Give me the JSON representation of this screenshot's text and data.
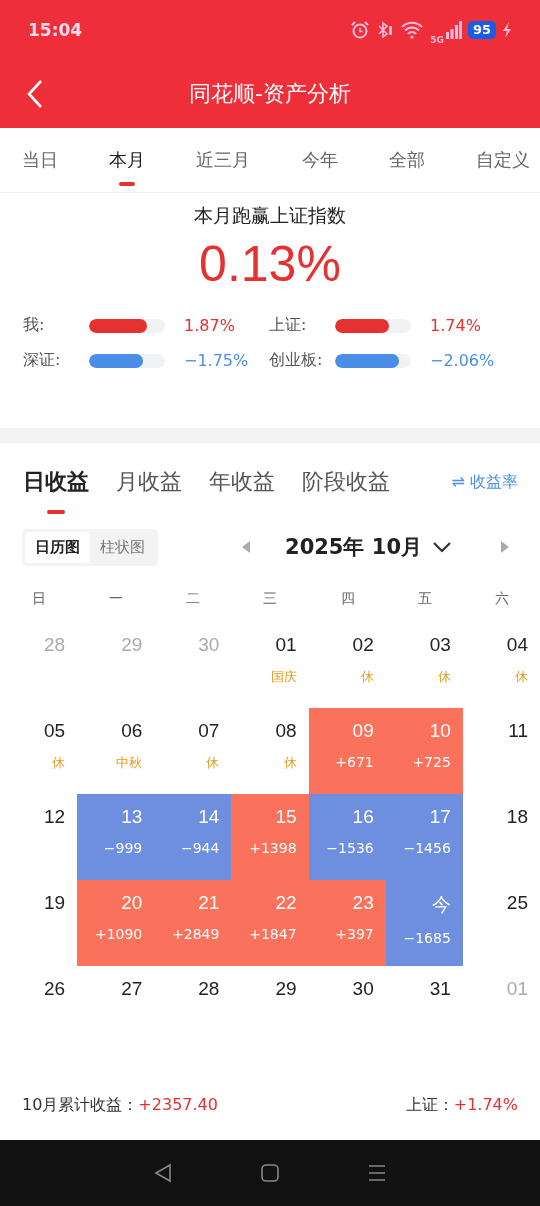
{
  "status_bar": {
    "time": "15:04",
    "network": "5G",
    "battery": "95"
  },
  "header": {
    "title": "同花顺-资产分析"
  },
  "period_tabs": [
    {
      "label": "当日",
      "selected": false
    },
    {
      "label": "本月",
      "selected": true
    },
    {
      "label": "近三月",
      "selected": false
    },
    {
      "label": "今年",
      "selected": false
    },
    {
      "label": "全部",
      "selected": false
    },
    {
      "label": "自定义",
      "selected": false
    }
  ],
  "summary": {
    "headline": "本月跑赢上证指数",
    "value": "0.13%",
    "comparisons": [
      {
        "label": "我:",
        "level": 0.76,
        "value": "1.87%",
        "color": "#e5312f"
      },
      {
        "label": "上证:",
        "level": 0.71,
        "value": "1.74%",
        "color": "#e5312f"
      },
      {
        "label": "深证:",
        "level": 0.71,
        "value": "−1.75%",
        "color": "#4a8fe7"
      },
      {
        "label": "创业板:",
        "level": 0.84,
        "value": "−2.06%",
        "color": "#4a8fe7"
      }
    ]
  },
  "section_tabs": [
    {
      "label": "日收益",
      "selected": true
    },
    {
      "label": "月收益",
      "selected": false
    },
    {
      "label": "年收益",
      "selected": false
    },
    {
      "label": "阶段收益",
      "selected": false
    }
  ],
  "rate_toggle": {
    "icon": "⇌",
    "label": "收益率"
  },
  "view_toggle": [
    {
      "label": "日历图",
      "selected": true
    },
    {
      "label": "柱状图",
      "selected": false
    }
  ],
  "month_picker": {
    "label": "2025年 10月"
  },
  "weekdays": [
    "日",
    "一",
    "二",
    "三",
    "四",
    "五",
    "六"
  ],
  "calendar": [
    {
      "day": "28",
      "kind": "outside"
    },
    {
      "day": "29",
      "kind": "outside"
    },
    {
      "day": "30",
      "kind": "outside"
    },
    {
      "day": "01",
      "kind": "plain",
      "note": "国庆"
    },
    {
      "day": "02",
      "kind": "plain",
      "note": "休"
    },
    {
      "day": "03",
      "kind": "plain",
      "note": "休"
    },
    {
      "day": "04",
      "kind": "plain",
      "note": "休"
    },
    {
      "day": "05",
      "kind": "plain",
      "note": "休"
    },
    {
      "day": "06",
      "kind": "plain",
      "note": "中秋"
    },
    {
      "day": "07",
      "kind": "plain",
      "note": "休"
    },
    {
      "day": "08",
      "kind": "plain",
      "note": "休"
    },
    {
      "day": "09",
      "kind": "gain",
      "pnl": "+671"
    },
    {
      "day": "10",
      "kind": "gain",
      "pnl": "+725"
    },
    {
      "day": "11",
      "kind": "plain"
    },
    {
      "day": "12",
      "kind": "plain"
    },
    {
      "day": "13",
      "kind": "loss",
      "pnl": "−999"
    },
    {
      "day": "14",
      "kind": "loss",
      "pnl": "−944"
    },
    {
      "day": "15",
      "kind": "gain",
      "pnl": "+1398"
    },
    {
      "day": "16",
      "kind": "loss",
      "pnl": "−1536"
    },
    {
      "day": "17",
      "kind": "loss",
      "pnl": "−1456"
    },
    {
      "day": "18",
      "kind": "plain"
    },
    {
      "day": "19",
      "kind": "plain"
    },
    {
      "day": "20",
      "kind": "gain",
      "pnl": "+1090"
    },
    {
      "day": "21",
      "kind": "gain",
      "pnl": "+2849"
    },
    {
      "day": "22",
      "kind": "gain",
      "pnl": "+1847"
    },
    {
      "day": "23",
      "kind": "gain",
      "pnl": "+397"
    },
    {
      "day": "今",
      "kind": "loss",
      "pnl": "−1685"
    },
    {
      "day": "25",
      "kind": "plain"
    },
    {
      "day": "26",
      "kind": "plain"
    },
    {
      "day": "27",
      "kind": "plain"
    },
    {
      "day": "28",
      "kind": "plain"
    },
    {
      "day": "29",
      "kind": "plain"
    },
    {
      "day": "30",
      "kind": "plain"
    },
    {
      "day": "31",
      "kind": "plain"
    },
    {
      "day": "01",
      "kind": "outside"
    }
  ],
  "footer": {
    "total_label": "10月累计收益：",
    "total_value": "+2357.40",
    "index_label": "上证：",
    "index_value": "+1.74%"
  }
}
